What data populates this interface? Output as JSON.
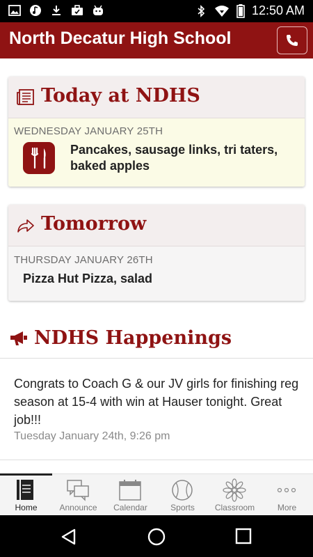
{
  "status_bar": {
    "time": "12:50 AM",
    "left_icons": [
      "image-icon",
      "music-icon",
      "download-icon",
      "briefcase-icon",
      "android-icon"
    ],
    "right_icons": [
      "bluetooth-icon",
      "wifi-icon",
      "battery-icon"
    ]
  },
  "app_bar": {
    "title": "North Decatur High School",
    "call_icon": "phone-icon",
    "color": "#8f1313"
  },
  "today_card": {
    "title": "Today at NDHS",
    "date": "WEDNESDAY JANUARY 25TH",
    "menu": "Pancakes, sausage links, tri taters, baked apples",
    "icon": "fork-knife-icon"
  },
  "tomorrow_card": {
    "title": "Tomorrow",
    "date": "THURSDAY JANUARY 26TH",
    "menu": "Pizza Hut Pizza, salad"
  },
  "happenings": {
    "title": "NDHS Happenings",
    "posts": [
      {
        "text": "Congrats to Coach G & our JV girls for finishing reg season at 15-4 with win at Hauser tonight. Great job!!!",
        "time": "Tuesday January 24th, 9:26 pm"
      }
    ]
  },
  "tabs": [
    {
      "label": "Home",
      "icon": "home-book-icon",
      "active": true
    },
    {
      "label": "Announce",
      "icon": "chat-bubbles-icon",
      "active": false
    },
    {
      "label": "Calendar",
      "icon": "calendar-icon",
      "active": false
    },
    {
      "label": "Sports",
      "icon": "baseball-icon",
      "active": false
    },
    {
      "label": "Classroom",
      "icon": "flower-icon",
      "active": false
    },
    {
      "label": "More",
      "icon": "more-dots-icon",
      "active": false
    }
  ],
  "nav_bar": {
    "icons": [
      "back-icon",
      "home-icon",
      "recents-icon"
    ]
  }
}
